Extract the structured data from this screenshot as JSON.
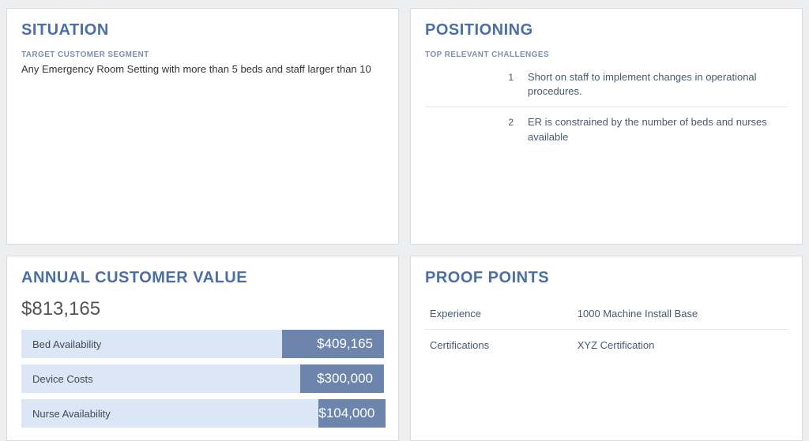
{
  "situation": {
    "heading": "SITUATION",
    "sublabel": "TARGET CUSTOMER SEGMENT",
    "text": "Any Emergency Room Setting with more than 5 beds and staff larger than 10"
  },
  "positioning": {
    "heading": "POSITIONING",
    "sublabel": "TOP RELEVANT CHALLENGES",
    "items": [
      {
        "n": "1",
        "text": "Short on staff to implement changes in operational procedures."
      },
      {
        "n": "2",
        "text": "ER is constrained by the number of beds and nurses available"
      }
    ]
  },
  "acv": {
    "heading": "ANNUAL CUSTOMER VALUE",
    "total": "$813,165",
    "rows": [
      {
        "label": "Bed Availability",
        "value": "$409,165",
        "label_pct": 72,
        "value_pct": 28
      },
      {
        "label": "Device Costs",
        "value": "$300,000",
        "label_pct": 77,
        "value_pct": 23
      },
      {
        "label": "Nurse Availability",
        "value": "$104,000",
        "label_pct": 82,
        "value_pct": 18
      }
    ]
  },
  "proof": {
    "heading": "PROOF POINTS",
    "rows": [
      {
        "key": "Experience",
        "val": "1000 Machine Install Base"
      },
      {
        "key": "Certifications",
        "val": "XYZ Certification"
      }
    ]
  },
  "chart_data": {
    "type": "bar",
    "title": "Annual Customer Value",
    "total": 813165,
    "categories": [
      "Bed Availability",
      "Device Costs",
      "Nurse Availability"
    ],
    "values": [
      409165,
      300000,
      104000
    ],
    "xlabel": "",
    "ylabel": "USD"
  }
}
